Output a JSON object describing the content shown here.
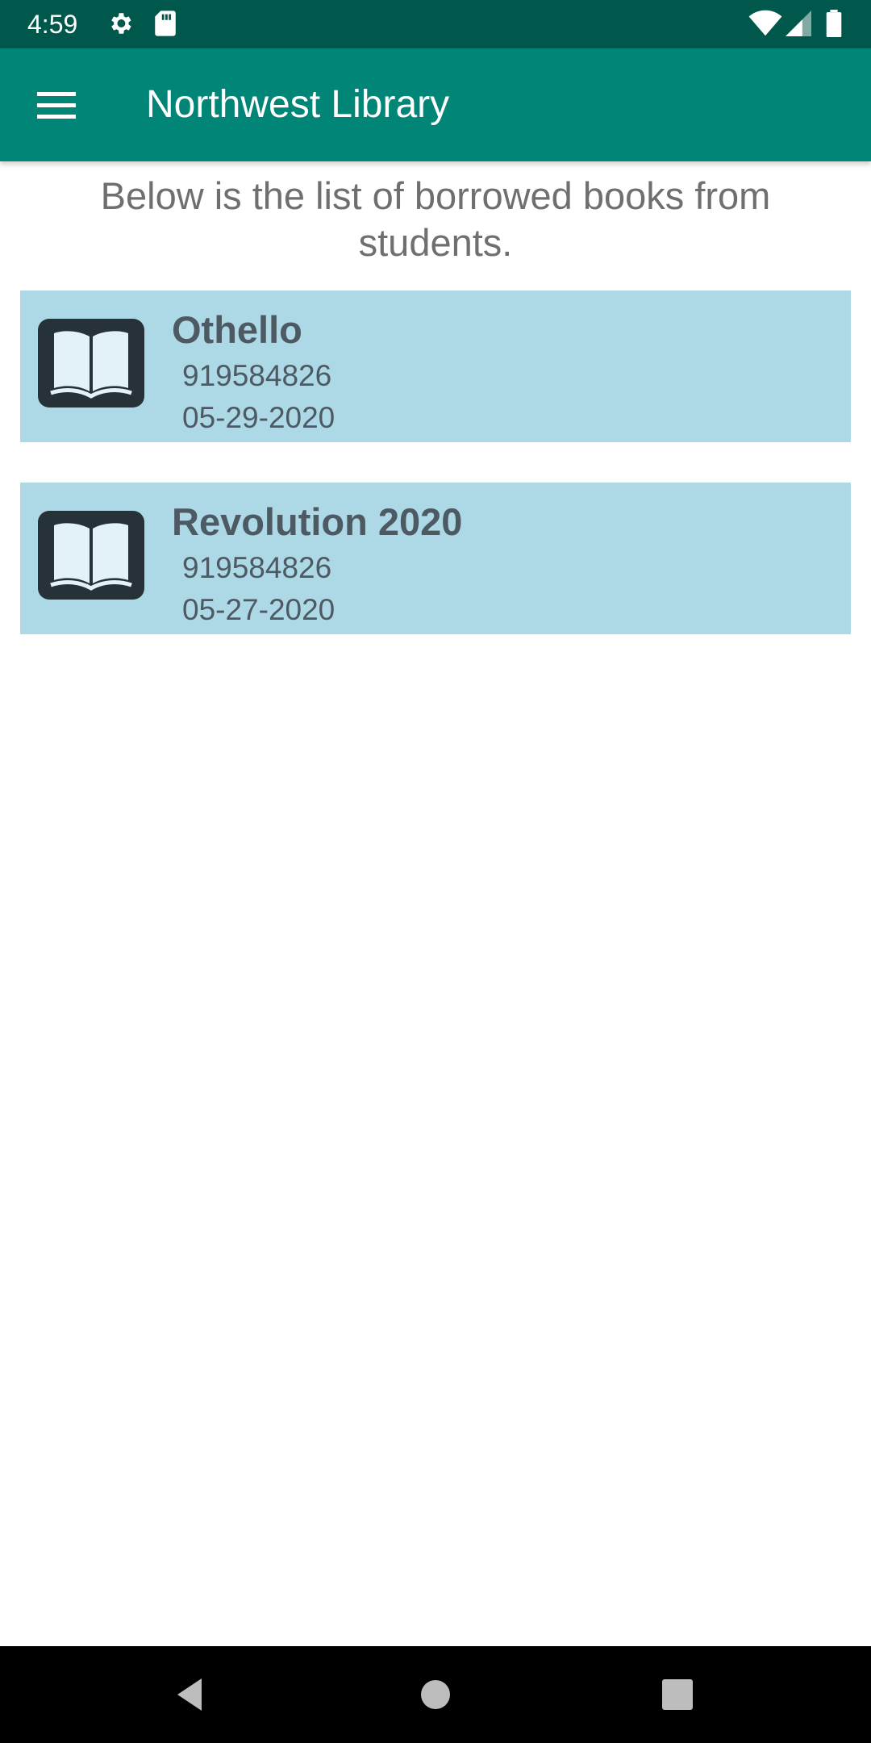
{
  "status_bar": {
    "time": "4:59",
    "left_icons": [
      "gear-icon",
      "sd-card-icon"
    ],
    "right_icons": [
      "wifi-icon",
      "cell-signal-icon",
      "battery-icon"
    ]
  },
  "app_bar": {
    "title": "Northwest Library",
    "menu_icon": "hamburger-menu-icon",
    "background": "#008577"
  },
  "intro_text": "Below is the list of borrowed books from students.",
  "books": [
    {
      "title": "Othello",
      "student_id": "919584826",
      "date": "05-29-2020",
      "icon": "open-book-icon"
    },
    {
      "title": "Revolution 2020",
      "student_id": "919584826",
      "date": "05-27-2020",
      "icon": "open-book-icon"
    }
  ],
  "colors": {
    "status_bar": "#00574B",
    "accent": "#008577",
    "item_background": "#ADD8E6",
    "item_text": "#4d5a63"
  },
  "nav_bar": {
    "icons": [
      "back-icon",
      "home-icon",
      "recents-icon"
    ]
  }
}
